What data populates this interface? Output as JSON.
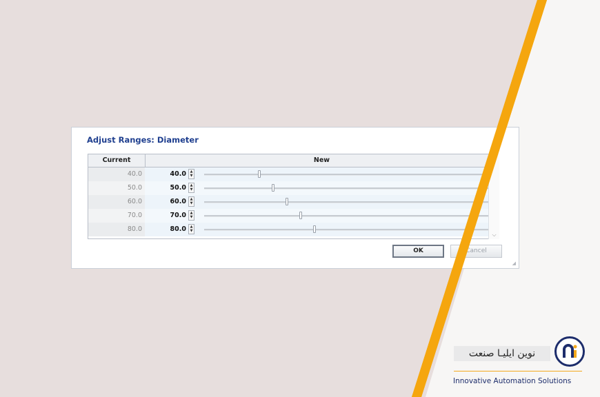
{
  "dialog": {
    "title": "Adjust Ranges: Diameter",
    "columns": {
      "current": "Current",
      "new": "New"
    },
    "rows": [
      {
        "current": "40.0",
        "new": "40.0",
        "slider_level": 0.16
      },
      {
        "current": "50.0",
        "new": "50.0",
        "slider_level": 0.2
      },
      {
        "current": "60.0",
        "new": "60.0",
        "slider_level": 0.24
      },
      {
        "current": "70.0",
        "new": "70.0",
        "slider_level": 0.28
      },
      {
        "current": "80.0",
        "new": "80.0",
        "slider_level": 0.32
      }
    ],
    "ok_label": "OK",
    "cancel_label": "Cancel"
  },
  "brand": {
    "name_fa": "نوین ایلیـا صنعت",
    "tagline": "Innovative Automation Solutions",
    "accent_color": "#f4a81b",
    "navy_color": "#1d2d6b"
  },
  "icons": [
    "spin-up-icon",
    "spin-down-icon",
    "scroll-down-arrow-icon",
    "resize-grip-icon",
    "brand-logo-icon"
  ]
}
